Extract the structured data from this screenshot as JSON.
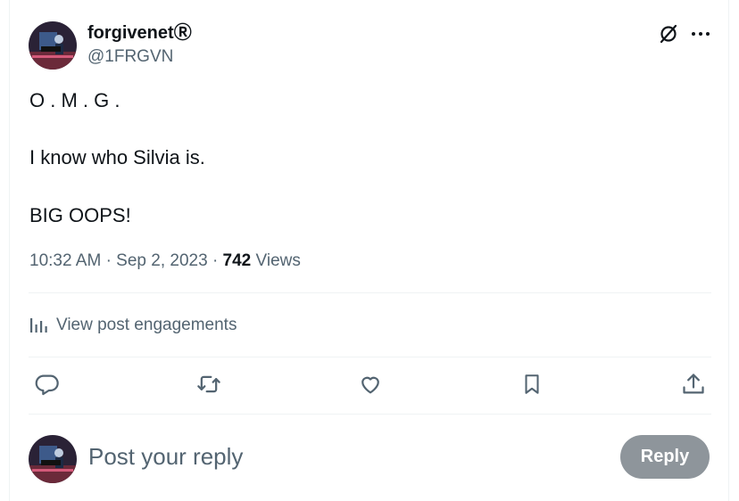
{
  "tweet": {
    "author_name": "forgivenet",
    "registered_mark": "Ⓡ",
    "author_handle": "@1FRGVN",
    "lines": [
      "O . M . G .",
      "I know who Silvia is.",
      "BIG OOPS!"
    ],
    "time": "10:32 AM",
    "sep1": "·",
    "date": "Sep 2, 2023",
    "sep2": "·",
    "views_count": "742",
    "views_label": "Views"
  },
  "engagements_label": "View post engagements",
  "actions": [
    "reply-icon",
    "retweet-icon",
    "like-icon",
    "bookmark-icon",
    "share-icon"
  ],
  "reply_box": {
    "placeholder": "Post your reply",
    "button_label": "Reply"
  },
  "colors": {
    "text": "#0f1419",
    "secondary": "#536471",
    "divider": "#eff3f4",
    "reply_button": "#8e959b"
  }
}
